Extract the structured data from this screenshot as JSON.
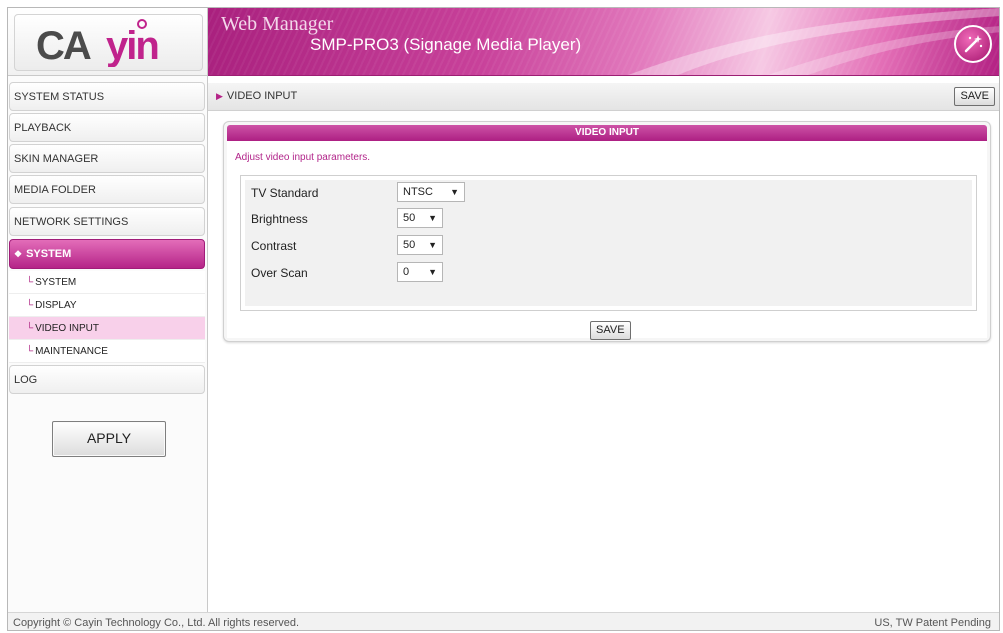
{
  "logo": {
    "text": "CAYIN"
  },
  "header": {
    "app_name": "Web Manager",
    "subtitle": "SMP-PRO3 (Signage Media Player)",
    "badge_icon": "magic-wand-icon"
  },
  "sidebar": {
    "items": [
      {
        "label": "SYSTEM STATUS"
      },
      {
        "label": "PLAYBACK"
      },
      {
        "label": "SKIN MANAGER"
      },
      {
        "label": "MEDIA FOLDER"
      },
      {
        "label": "NETWORK SETTINGS"
      },
      {
        "label": "SYSTEM",
        "active": true
      },
      {
        "label": "LOG"
      }
    ],
    "sub_items": [
      {
        "label": "SYSTEM"
      },
      {
        "label": "DISPLAY"
      },
      {
        "label": "VIDEO INPUT",
        "active": true
      },
      {
        "label": "MAINTENANCE"
      }
    ],
    "apply_label": "APPLY"
  },
  "page": {
    "title": "VIDEO INPUT",
    "save_label": "SAVE"
  },
  "panel": {
    "heading": "VIDEO INPUT",
    "description": "Adjust video input parameters.",
    "fields": [
      {
        "label": "TV Standard",
        "value": "NTSC"
      },
      {
        "label": "Brightness",
        "value": "50"
      },
      {
        "label": "Contrast",
        "value": "50"
      },
      {
        "label": "Over Scan",
        "value": "0"
      }
    ],
    "save_label": "SAVE"
  },
  "footer": {
    "copyright": "Copyright © Cayin Technology Co., Ltd. All rights reserved.",
    "patent": "US, TW Patent Pending"
  },
  "colors": {
    "accent": "#b52488",
    "accent_light": "#f8d0ea",
    "header_dark": "#a9207e"
  }
}
